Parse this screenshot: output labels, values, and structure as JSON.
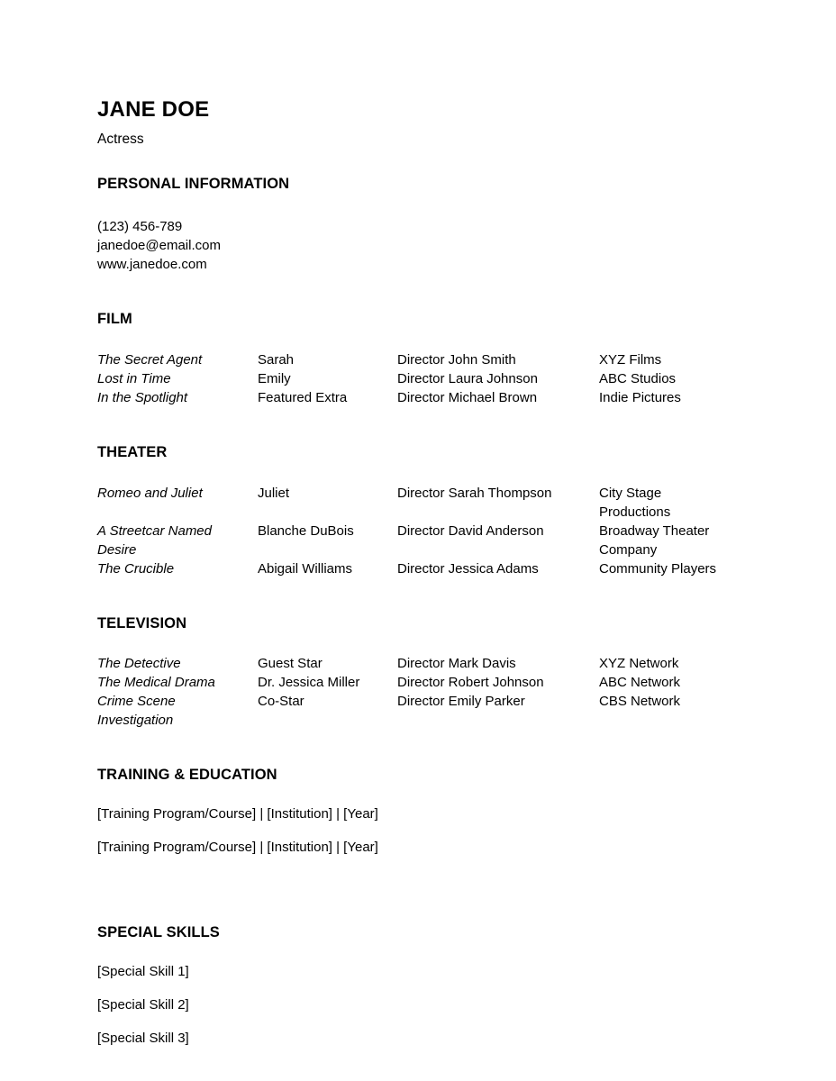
{
  "header": {
    "name": "JANE DOE",
    "role": "Actress"
  },
  "personal_information": {
    "heading": "PERSONAL INFORMATION",
    "phone": "(123) 456-789",
    "email": "janedoe@email.com",
    "website": "www.janedoe.com"
  },
  "film": {
    "heading": "FILM",
    "rows": [
      {
        "title": "The Secret Agent",
        "role": "Sarah",
        "director": "Director John Smith",
        "company": "XYZ Films"
      },
      {
        "title": "Lost in Time",
        "role": "Emily",
        "director": "Director Laura Johnson",
        "company": "ABC Studios"
      },
      {
        "title": "In the Spotlight",
        "role": "Featured Extra",
        "director": "Director Michael Brown",
        "company": "Indie Pictures"
      }
    ]
  },
  "theater": {
    "heading": "THEATER",
    "rows": [
      {
        "title": "Romeo and Juliet",
        "role": "Juliet",
        "director": "Director Sarah Thompson",
        "company": "City Stage Productions"
      },
      {
        "title": "A Streetcar Named Desire",
        "role": "Blanche DuBois",
        "director": "Director David Anderson",
        "company": "Broadway Theater Company"
      },
      {
        "title": "The Crucible",
        "role": "Abigail Williams",
        "director": "Director Jessica Adams",
        "company": "Community Players"
      }
    ]
  },
  "television": {
    "heading": "TELEVISION",
    "rows": [
      {
        "title": "The Detective",
        "role": "Guest Star",
        "director": "Director Mark Davis",
        "company": "XYZ Network"
      },
      {
        "title": "The Medical Drama",
        "role": "Dr. Jessica Miller",
        "director": "Director Robert Johnson",
        "company": "ABC Network"
      },
      {
        "title": "Crime Scene Investigation",
        "role": "Co-Star",
        "director": "Director Emily Parker",
        "company": "CBS Network"
      }
    ]
  },
  "training": {
    "heading": "TRAINING & EDUCATION",
    "entries": [
      "[Training Program/Course] | [Institution] | [Year]",
      "[Training Program/Course] | [Institution] | [Year]"
    ]
  },
  "skills": {
    "heading": "SPECIAL SKILLS",
    "entries": [
      "[Special Skill 1]",
      "[Special Skill 2]",
      "[Special Skill 3]"
    ]
  }
}
